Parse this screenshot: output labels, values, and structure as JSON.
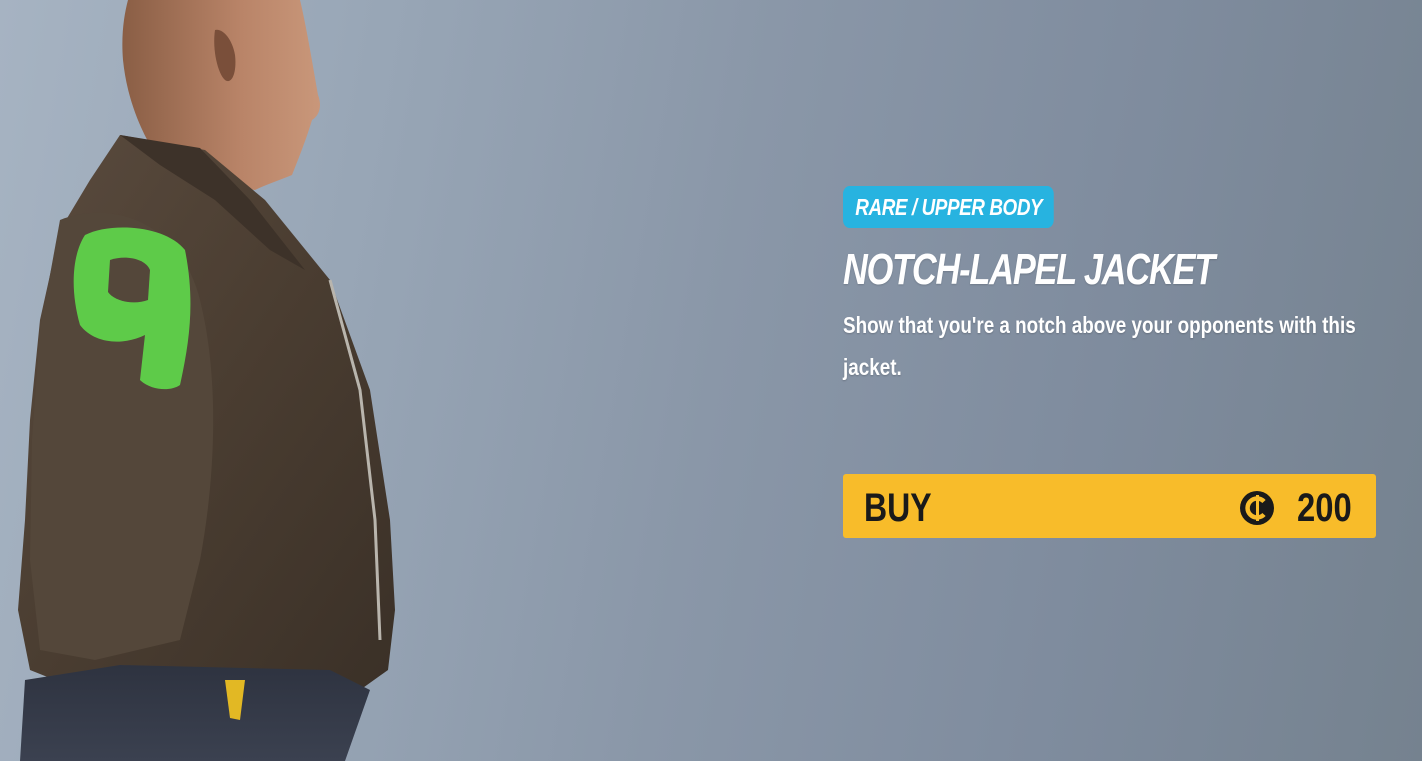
{
  "item": {
    "rarity_category": "RARE / UPPER BODY",
    "name": "NOTCH-LAPEL JACKET",
    "description": "Show that you're a notch above your opponents with this jacket."
  },
  "purchase": {
    "buy_label": "BUY",
    "currency_icon": "coin-icon",
    "price": "200"
  },
  "colors": {
    "rarity_badge": "#27b3e0",
    "buy_button": "#f8bc2a",
    "jacket": "#4a3e33",
    "jacket_number": "#5fd34a"
  }
}
